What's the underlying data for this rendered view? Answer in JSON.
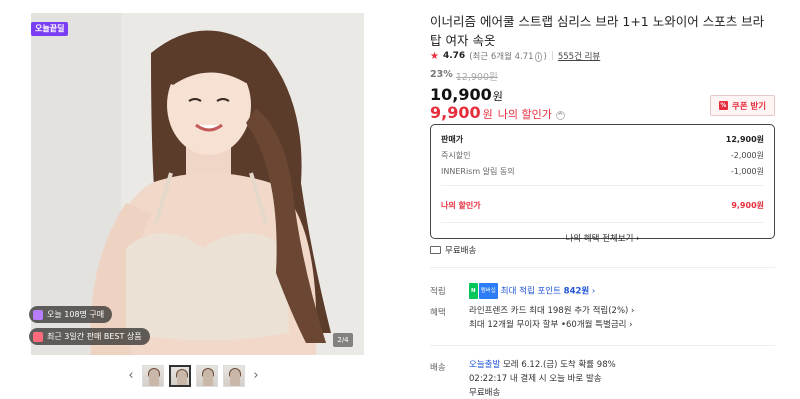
{
  "gallery": {
    "today_badge": "오늘끝딜",
    "pill_sales": "오늘 108명 구매",
    "pill_best": "최근 3일간 판매 BEST 상품",
    "counter": "2/4",
    "prev_arrow": "‹",
    "next_arrow": "›",
    "thumbnails": [
      "thumb-1",
      "thumb-2",
      "thumb-3",
      "thumb-4"
    ],
    "active_thumb_index": 1
  },
  "product": {
    "title": "이너리즘 에어쿨 스트랩 심리스 브라 1+1 노와이어 스포츠 브라탑 여자 속옷",
    "rating": {
      "score": "4.76",
      "recent": "(최근 6개월 4.71",
      "recent_close": ")",
      "reviews": "555건 리뷰"
    },
    "discount_rate": "23%",
    "original_price": "12,900원",
    "price": "10,900",
    "price_unit": "원",
    "my_price": "9,900",
    "my_price_unit": "원",
    "my_price_label": "나의 할인가",
    "coupon_button": "쿠폰 받기"
  },
  "price_box": {
    "sale_price_label": "판매가",
    "sale_price_value": "12,900원",
    "instant_discount_label": "즉시할인",
    "instant_discount_value": "-2,000원",
    "alarm_discount_label": "INNERism 알림 동의",
    "alarm_discount_value": "-1,000원",
    "my_price_label": "나의 할인가",
    "my_price_value": "9,900원",
    "benefit_link": "나의 혜택 전체보기 ›"
  },
  "shipping_free": "무료배송",
  "info": {
    "points_label": "적립",
    "np_badge_1": "N",
    "np_badge_2": "멤버십",
    "points_text": "최대 적립 포인트 ",
    "points_value": "842원",
    "points_chevron": " ›",
    "benefit_label": "혜택",
    "benefit_line1": "라인프렌즈 카드 최대 198원 추가 적립(2%) ›",
    "benefit_line2": "최대 12개월 무이자 할부 •60개월 특별금리 ›",
    "delivery_label": "배송",
    "delivery_today": "오늘출발",
    "delivery_line1": " 모레 6.12.(금) 도착 확률 98%",
    "delivery_line2": "02:22:17  내 결제 시 오늘 바로 발송",
    "delivery_line3": "무료배송"
  },
  "colors": {
    "accent_red": "#e62e3d",
    "badge_purple": "#7b3df4",
    "link_blue": "#1f55d6"
  }
}
